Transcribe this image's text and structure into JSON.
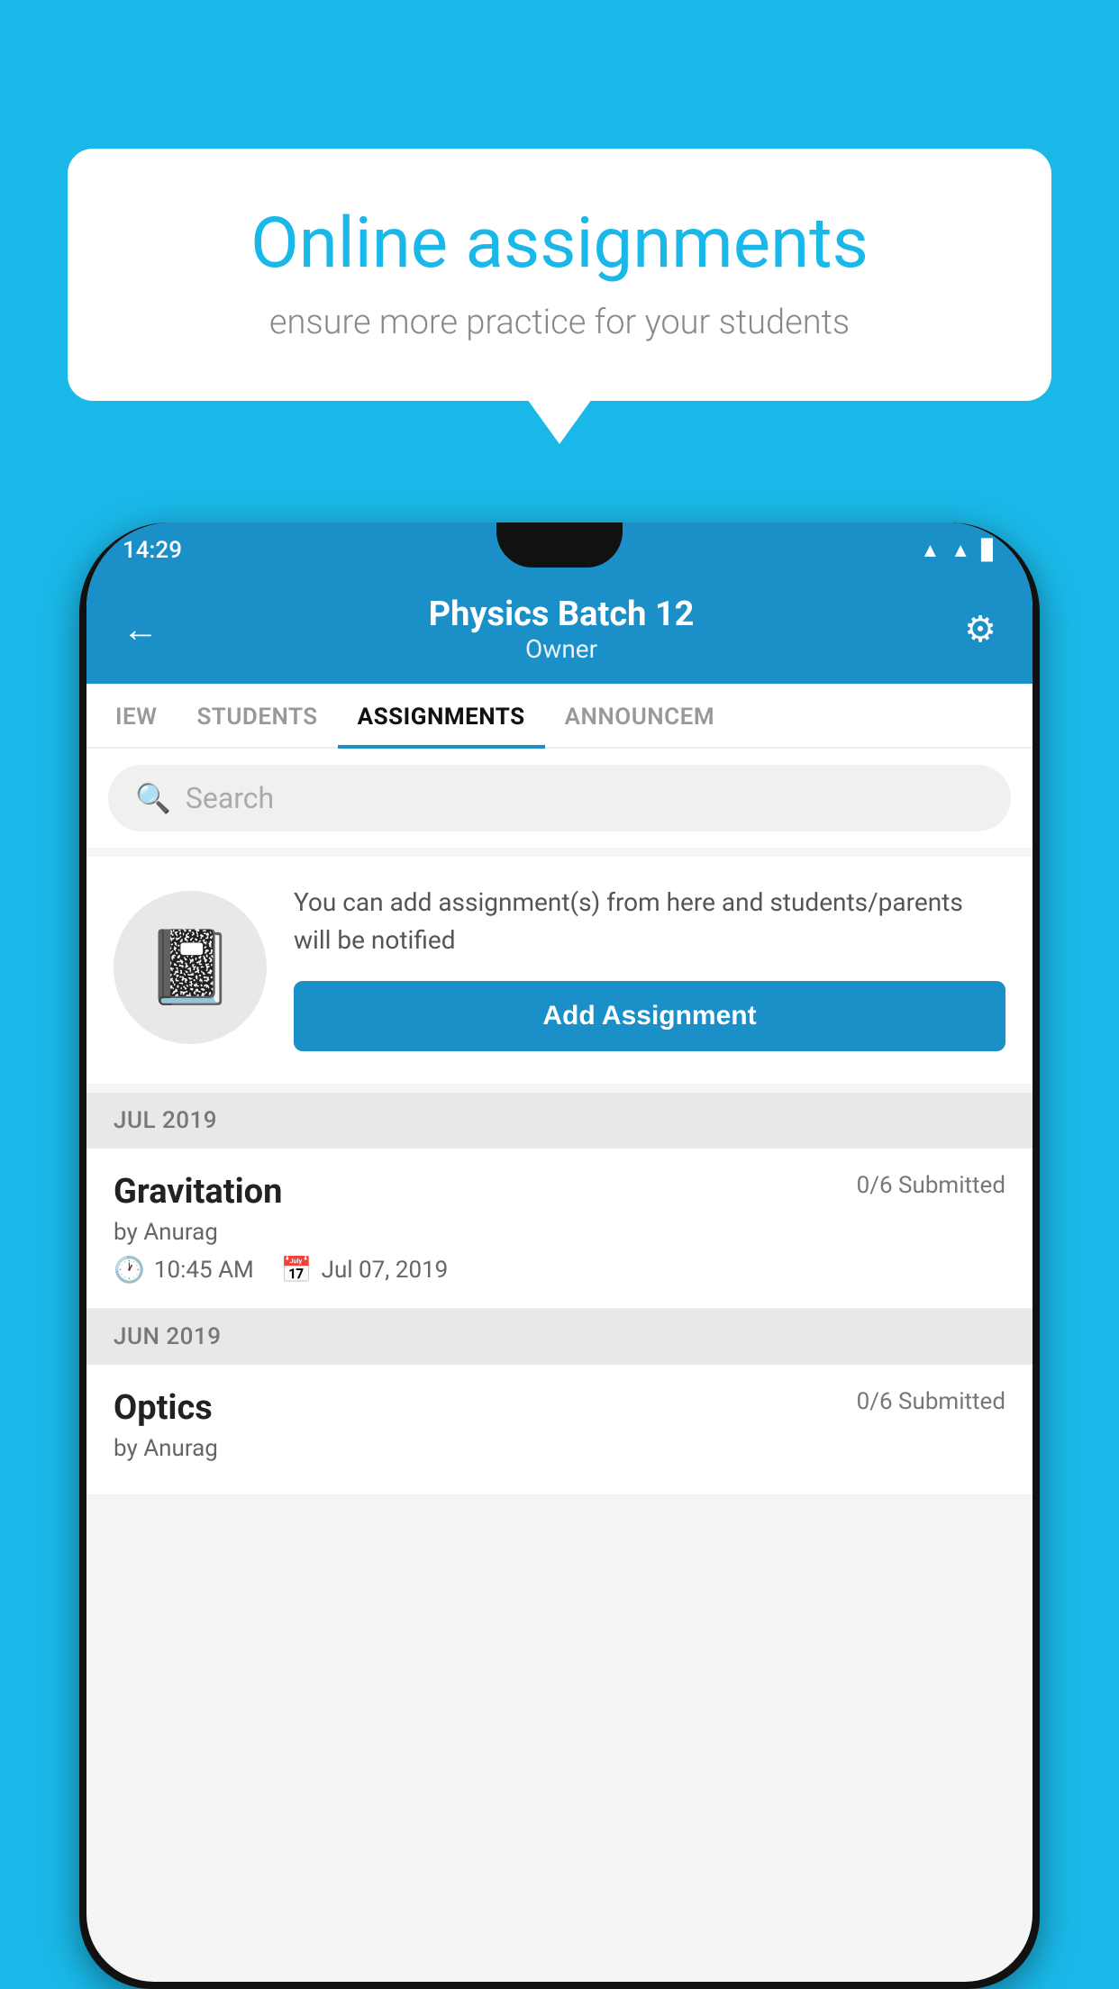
{
  "background": {
    "color": "#1ab8e8"
  },
  "bubble": {
    "title": "Online assignments",
    "subtitle": "ensure more practice for your students"
  },
  "status_bar": {
    "time": "14:29",
    "icons": [
      "wifi",
      "signal",
      "battery"
    ]
  },
  "header": {
    "title": "Physics Batch 12",
    "subtitle": "Owner",
    "back_label": "←",
    "gear_label": "⚙"
  },
  "tabs": [
    {
      "label": "IEW",
      "active": false
    },
    {
      "label": "STUDENTS",
      "active": false
    },
    {
      "label": "ASSIGNMENTS",
      "active": true
    },
    {
      "label": "ANNOUNCEM",
      "active": false
    }
  ],
  "search": {
    "placeholder": "Search"
  },
  "add_section": {
    "description": "You can add assignment(s) from here and students/parents will be notified",
    "button_label": "Add Assignment"
  },
  "month_groups": [
    {
      "month": "JUL 2019",
      "assignments": [
        {
          "name": "Gravitation",
          "submitted": "0/6 Submitted",
          "by": "by Anurag",
          "time": "10:45 AM",
          "date": "Jul 07, 2019"
        }
      ]
    },
    {
      "month": "JUN 2019",
      "assignments": [
        {
          "name": "Optics",
          "submitted": "0/6 Submitted",
          "by": "by Anurag",
          "time": "",
          "date": ""
        }
      ]
    }
  ]
}
